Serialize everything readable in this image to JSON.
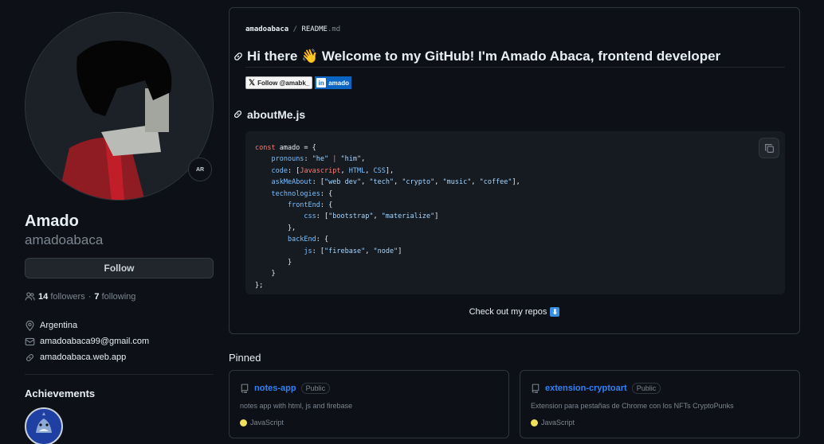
{
  "profile": {
    "name": "Amado",
    "username": "amadoabaca",
    "status_badge": "AR",
    "follow_label": "Follow",
    "followers_count": "14",
    "followers_label": "followers",
    "separator": "·",
    "following_count": "7",
    "following_label": "following",
    "location": "Argentina",
    "email": "amadoabaca99@gmail.com",
    "website": "amadoabaca.web.app",
    "achievements_title": "Achievements"
  },
  "readme": {
    "owner": "amadoabaca",
    "sep": "/",
    "file": "README",
    "ext": ".md",
    "heading": "Hi there 👋 Welcome to my GitHub! I'm Amado Abaca, frontend developer",
    "twitter_badge": "Follow @amabk_",
    "linkedin_logo": "in",
    "linkedin_badge": "amado",
    "section_title": "aboutMe.js",
    "checkout": "Check out my repos",
    "checkout_emoji": "⬇"
  },
  "code": {
    "l1a": "const",
    "l1b": " amado = {",
    "l2k": "pronouns",
    "l2v": "\"he\"",
    "l2p": " | ",
    "l2v2": "\"him\"",
    "l3k": "code",
    "l3a": "Javascript",
    "l3b": "HTML",
    "l3c": "CSS",
    "l4k": "askMeAbout",
    "l4a": "\"web dev\"",
    "l4b": "\"tech\"",
    "l4c": "\"crypto\"",
    "l4d": "\"music\"",
    "l4e": "\"coffee\"",
    "l5k": "technologies",
    "l6k": "frontEnd",
    "l7k": "css",
    "l7a": "\"bootstrap\"",
    "l7b": "\"materialize\"",
    "l9k": "backEnd",
    "l10k": "js",
    "l10a": "\"firebase\"",
    "l10b": "\"node\""
  },
  "pinned": {
    "title": "Pinned",
    "repos": [
      {
        "name": "notes-app",
        "visibility": "Public",
        "description": "notes app with html, js and firebase",
        "language": "JavaScript",
        "lang_color": "#f1e05a"
      },
      {
        "name": "extension-cryptoart",
        "visibility": "Public",
        "description": "Extension para pestañas de Chrome con los NFTs CryptoPunks",
        "language": "JavaScript",
        "lang_color": "#f1e05a"
      }
    ]
  },
  "colors": {
    "background": "#0d1117",
    "border": "#30363d",
    "link": "#2f81f7",
    "muted": "#7d8590",
    "keyword": "#ff7b72",
    "string": "#a5d6ff"
  },
  "icons": [
    "people-icon",
    "location-icon",
    "mail-icon",
    "link-icon",
    "copy-icon",
    "repo-icon"
  ]
}
